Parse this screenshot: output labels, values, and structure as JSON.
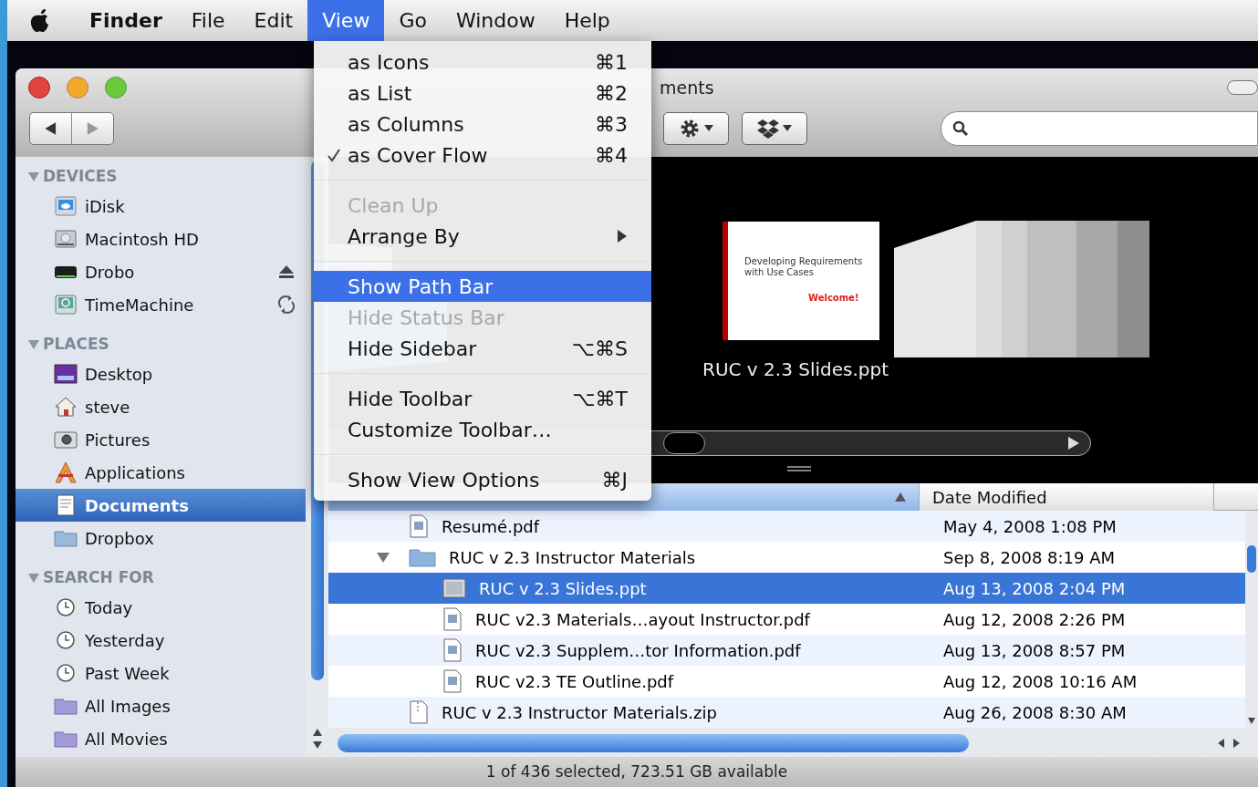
{
  "menubar": {
    "items": [
      {
        "label": "Finder",
        "selected": false,
        "bold": true
      },
      {
        "label": "File",
        "selected": false,
        "bold": false
      },
      {
        "label": "Edit",
        "selected": false,
        "bold": false
      },
      {
        "label": "View",
        "selected": true,
        "bold": false
      },
      {
        "label": "Go",
        "selected": false,
        "bold": false
      },
      {
        "label": "Window",
        "selected": false,
        "bold": false
      },
      {
        "label": "Help",
        "selected": false,
        "bold": false
      }
    ]
  },
  "view_menu": {
    "groups": [
      {
        "items": [
          {
            "label": "as Icons",
            "shortcut": "⌘1",
            "checked": false,
            "disabled": false,
            "selected": false,
            "submenu": false
          },
          {
            "label": "as List",
            "shortcut": "⌘2",
            "checked": false,
            "disabled": false,
            "selected": false,
            "submenu": false
          },
          {
            "label": "as Columns",
            "shortcut": "⌘3",
            "checked": false,
            "disabled": false,
            "selected": false,
            "submenu": false
          },
          {
            "label": "as Cover Flow",
            "shortcut": "⌘4",
            "checked": true,
            "disabled": false,
            "selected": false,
            "submenu": false
          }
        ]
      },
      {
        "items": [
          {
            "label": "Clean Up",
            "checked": false,
            "disabled": true,
            "selected": false,
            "submenu": false
          },
          {
            "label": "Arrange By",
            "checked": false,
            "disabled": false,
            "selected": false,
            "submenu": true
          }
        ]
      },
      {
        "items": [
          {
            "label": "Show Path Bar",
            "checked": false,
            "disabled": false,
            "selected": true,
            "submenu": false
          },
          {
            "label": "Hide Status Bar",
            "checked": false,
            "disabled": true,
            "selected": false,
            "submenu": false
          },
          {
            "label": "Hide Sidebar",
            "shortcut": "⌥⌘S",
            "checked": false,
            "disabled": false,
            "selected": false,
            "submenu": false
          }
        ]
      },
      {
        "items": [
          {
            "label": "Hide Toolbar",
            "shortcut": "⌥⌘T",
            "checked": false,
            "disabled": false,
            "selected": false,
            "submenu": false
          },
          {
            "label": "Customize Toolbar…",
            "checked": false,
            "disabled": false,
            "selected": false,
            "submenu": false
          }
        ]
      },
      {
        "items": [
          {
            "label": "Show View Options",
            "shortcut": "⌘J",
            "checked": false,
            "disabled": false,
            "selected": false,
            "submenu": false
          }
        ]
      }
    ]
  },
  "window": {
    "title": "ments"
  },
  "sidebar": {
    "sections": [
      {
        "title": "DEVICES",
        "expanded": true,
        "items": [
          {
            "label": "iDisk",
            "kind": "idisk",
            "selected": false
          },
          {
            "label": "Macintosh HD",
            "kind": "hd",
            "selected": false
          },
          {
            "label": "Drobo",
            "kind": "drobo",
            "selected": false,
            "ejectable": true
          },
          {
            "label": "TimeMachine",
            "kind": "timemachine",
            "selected": false,
            "syncing": true
          }
        ]
      },
      {
        "title": "PLACES",
        "expanded": true,
        "items": [
          {
            "label": "Desktop",
            "kind": "desktop",
            "selected": false
          },
          {
            "label": "steve",
            "kind": "home",
            "selected": false
          },
          {
            "label": "Pictures",
            "kind": "pictures",
            "selected": false
          },
          {
            "label": "Applications",
            "kind": "applications",
            "selected": false
          },
          {
            "label": "Documents",
            "kind": "documents",
            "selected": true
          },
          {
            "label": "Dropbox",
            "kind": "folder",
            "selected": false
          }
        ]
      },
      {
        "title": "SEARCH FOR",
        "expanded": true,
        "items": [
          {
            "label": "Today",
            "kind": "clock",
            "selected": false
          },
          {
            "label": "Yesterday",
            "kind": "clock",
            "selected": false
          },
          {
            "label": "Past Week",
            "kind": "clock",
            "selected": false
          },
          {
            "label": "All Images",
            "kind": "smart",
            "selected": false
          },
          {
            "label": "All Movies",
            "kind": "smart",
            "selected": false
          }
        ]
      }
    ]
  },
  "cover_flow": {
    "caption": "RUC v 2.3 Slides.ppt",
    "slide": {
      "title": "Developing Requirements with Use Cases",
      "greeting": "Welcome!"
    }
  },
  "list": {
    "columns": [
      {
        "sorted": true
      },
      {
        "label": "Date Modified",
        "sorted": false
      }
    ],
    "rows": [
      {
        "name": "Resumé.pdf",
        "kind": "pdf",
        "date": "May 4, 2008 1:08 PM",
        "selected": false
      },
      {
        "name": "RUC v 2.3 Instructor Materials",
        "kind": "folder",
        "date": "Sep 8, 2008 8:19 AM",
        "selected": false,
        "expanded": true,
        "children": [
          {
            "name": "RUC v 2.3 Slides.ppt",
            "kind": "ppt",
            "date": "Aug 13, 2008 2:04 PM",
            "selected": true
          },
          {
            "name": "RUC v2.3 Materials…ayout Instructor.pdf",
            "kind": "pdf",
            "date": "Aug 12, 2008 2:26 PM",
            "selected": false
          },
          {
            "name": "RUC v2.3 Supplem…tor Information.pdf",
            "kind": "pdf",
            "date": "Aug 13, 2008 8:57 PM",
            "selected": false
          },
          {
            "name": "RUC v2.3 TE Outline.pdf",
            "kind": "pdf",
            "date": "Aug 12, 2008 10:16 AM",
            "selected": false
          }
        ]
      },
      {
        "name": "RUC v 2.3 Instructor Materials.zip",
        "kind": "zip",
        "date": "Aug 26, 2008 8:30 AM",
        "selected": false
      }
    ]
  },
  "status_bar": {
    "text": "1 of 436 selected, 723.51 GB available"
  }
}
